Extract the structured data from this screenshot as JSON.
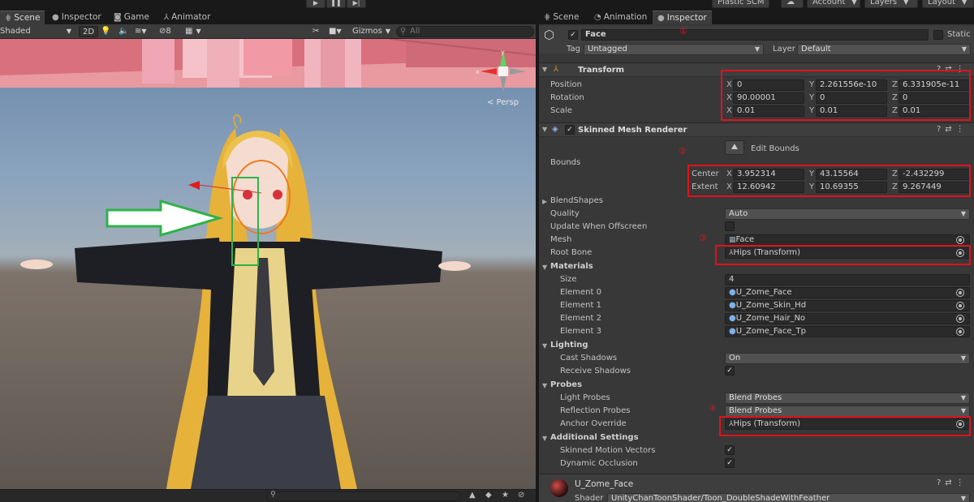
{
  "toolbar": {
    "plastic_scm": "Plastic SCM",
    "account": "Account",
    "layers": "Layers",
    "layout": "Layout"
  },
  "scene_tabs": [
    {
      "label": "Scene",
      "icon": "grid-icon"
    },
    {
      "label": "Inspector",
      "icon": "info-icon"
    },
    {
      "label": "Game",
      "icon": "gamepad-icon"
    },
    {
      "label": "Animator",
      "icon": "animator-icon"
    }
  ],
  "scene_toolbar": {
    "shading": "Shaded",
    "mode_2d": "2D",
    "hidden_count": "8",
    "gizmos": "Gizmos",
    "search_placeholder": "All"
  },
  "viewport": {
    "persp_label": "< Persp",
    "gizmo_axes": {
      "y": "y",
      "x": "x"
    }
  },
  "inspector_tabs": [
    {
      "label": "Scene",
      "icon": "grid-icon"
    },
    {
      "label": "Animation",
      "icon": "clock-icon"
    },
    {
      "label": "Inspector",
      "icon": "info-icon"
    }
  ],
  "object": {
    "name": "Face",
    "static_label": "Static",
    "tag_label": "Tag",
    "tag": "Untagged",
    "layer_label": "Layer",
    "layer": "Default"
  },
  "transform": {
    "title": "Transform",
    "rows": [
      {
        "label": "Position",
        "x": "0",
        "y": "2.261556e-10",
        "z": "6.331905e-11"
      },
      {
        "label": "Rotation",
        "x": "90.00001",
        "y": "0",
        "z": "0"
      },
      {
        "label": "Scale",
        "x": "0.01",
        "y": "0.01",
        "z": "0.01"
      }
    ]
  },
  "smr": {
    "title": "Skinned Mesh Renderer",
    "edit_bounds": "Edit Bounds",
    "bounds_label": "Bounds",
    "center_label": "Center",
    "center": {
      "x": "3.952314",
      "y": "43.15564",
      "z": "-2.432299"
    },
    "extent_label": "Extent",
    "extent": {
      "x": "12.60942",
      "y": "10.69355",
      "z": "9.267449"
    },
    "blendshapes_label": "BlendShapes",
    "quality_label": "Quality",
    "quality": "Auto",
    "update_offscreen_label": "Update When Offscreen",
    "mesh_label": "Mesh",
    "mesh": "Face",
    "root_bone_label": "Root Bone",
    "root_bone": "Hips (Transform)",
    "materials_label": "Materials",
    "size_label": "Size",
    "size": "4",
    "elements": [
      {
        "label": "Element 0",
        "value": "U_Zome_Face"
      },
      {
        "label": "Element 1",
        "value": "U_Zome_Skin_Hd"
      },
      {
        "label": "Element 2",
        "value": "U_Zome_Hair_No"
      },
      {
        "label": "Element 3",
        "value": "U_Zome_Face_Tp"
      }
    ],
    "lighting_label": "Lighting",
    "cast_shadows_label": "Cast Shadows",
    "cast_shadows": "On",
    "receive_shadows_label": "Receive Shadows",
    "probes_label": "Probes",
    "light_probes_label": "Light Probes",
    "light_probes": "Blend Probes",
    "reflection_probes_label": "Reflection Probes",
    "reflection_probes": "Blend Probes",
    "anchor_override_label": "Anchor Override",
    "anchor_override": "Hips (Transform)",
    "additional_label": "Additional Settings",
    "skinned_motion_label": "Skinned Motion Vectors",
    "dynamic_occlusion_label": "Dynamic Occlusion"
  },
  "material": {
    "name": "U_Zome_Face",
    "shader_label": "Shader",
    "shader": "UnityChanToonShader/Toon_DoubleShadeWithFeather"
  },
  "annotations": {
    "m1": "①",
    "m2": "②",
    "m3": "③",
    "m4": "④"
  },
  "colors": {
    "annotation_red": "#e1111b",
    "annotation_green": "#2fb24a"
  }
}
